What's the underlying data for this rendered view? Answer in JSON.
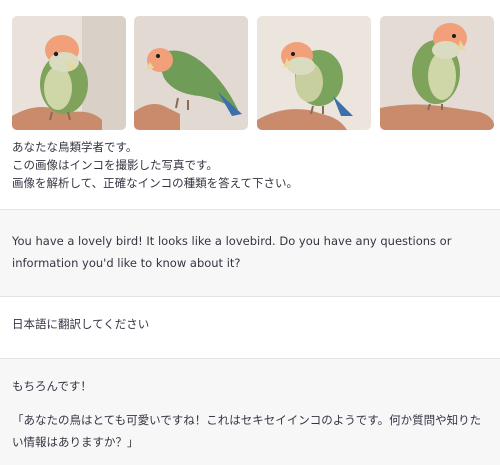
{
  "first_message": {
    "role": "user",
    "attachments": [
      {
        "icon": "lovebird-photo-1"
      },
      {
        "icon": "lovebird-photo-2"
      },
      {
        "icon": "lovebird-photo-3"
      },
      {
        "icon": "lovebird-photo-4"
      }
    ],
    "lines": [
      "あなたな鳥類学者です。",
      "この画像はインコを撮影した写真です。",
      "画像を解析して、正確なインコの種類を答えて下さい。"
    ]
  },
  "second_message": {
    "role": "assistant",
    "text": "You have a lovely bird! It looks like a lovebird. Do you have any questions or information you'd like to know about it?"
  },
  "third_message": {
    "role": "user",
    "text": "日本語に翻訳してください"
  },
  "fourth_message": {
    "role": "assistant",
    "line1": "もちろんです！",
    "line2": "「あなたの鳥はとても可愛いですね！これはセキセイインコのようです。何か質問や知りたい情報はありますか？」"
  },
  "colors": {
    "user_bg": "#ffffff",
    "assistant_bg": "#f7f7f8",
    "text": "#343541",
    "divider": "#e3e3e6"
  }
}
